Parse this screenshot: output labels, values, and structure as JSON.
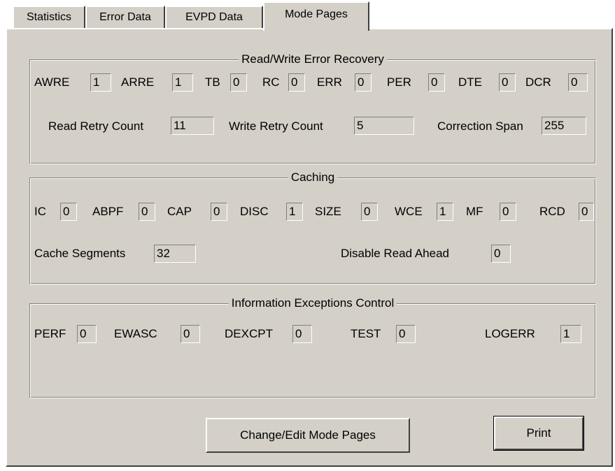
{
  "tabs": [
    {
      "label": "Statistics"
    },
    {
      "label": "Error Data"
    },
    {
      "label": "EVPD Data"
    },
    {
      "label": "Mode Pages"
    }
  ],
  "rw_recovery": {
    "title": "Read/Write Error Recovery",
    "flags": [
      {
        "label": "AWRE",
        "value": "1"
      },
      {
        "label": "ARRE",
        "value": "1"
      },
      {
        "label": "TB",
        "value": "0"
      },
      {
        "label": "RC",
        "value": "0"
      },
      {
        "label": "ERR",
        "value": "0"
      },
      {
        "label": "PER",
        "value": "0"
      },
      {
        "label": "DTE",
        "value": "0"
      },
      {
        "label": "DCR",
        "value": "0"
      }
    ],
    "read_retry_label": "Read Retry Count",
    "read_retry_value": "11",
    "write_retry_label": "Write Retry Count",
    "write_retry_value": "5",
    "correction_span_label": "Correction Span",
    "correction_span_value": "255"
  },
  "caching": {
    "title": "Caching",
    "flags": [
      {
        "label": "IC",
        "value": "0"
      },
      {
        "label": "ABPF",
        "value": "0"
      },
      {
        "label": "CAP",
        "value": "0"
      },
      {
        "label": "DISC",
        "value": "1"
      },
      {
        "label": "SIZE",
        "value": "0"
      },
      {
        "label": "WCE",
        "value": "1"
      },
      {
        "label": "MF",
        "value": "0"
      },
      {
        "label": "RCD",
        "value": "0"
      }
    ],
    "cache_segments_label": "Cache Segments",
    "cache_segments_value": "32",
    "disable_read_ahead_label": "Disable Read Ahead",
    "disable_read_ahead_value": "0"
  },
  "iec": {
    "title": "Information Exceptions Control",
    "flags": [
      {
        "label": "PERF",
        "value": "0"
      },
      {
        "label": "EWASC",
        "value": "0"
      },
      {
        "label": "DEXCPT",
        "value": "0"
      },
      {
        "label": "TEST",
        "value": "0"
      },
      {
        "label": "LOGERR",
        "value": "1"
      }
    ]
  },
  "buttons": {
    "change_edit": "Change/Edit Mode Pages",
    "print": "Print"
  }
}
